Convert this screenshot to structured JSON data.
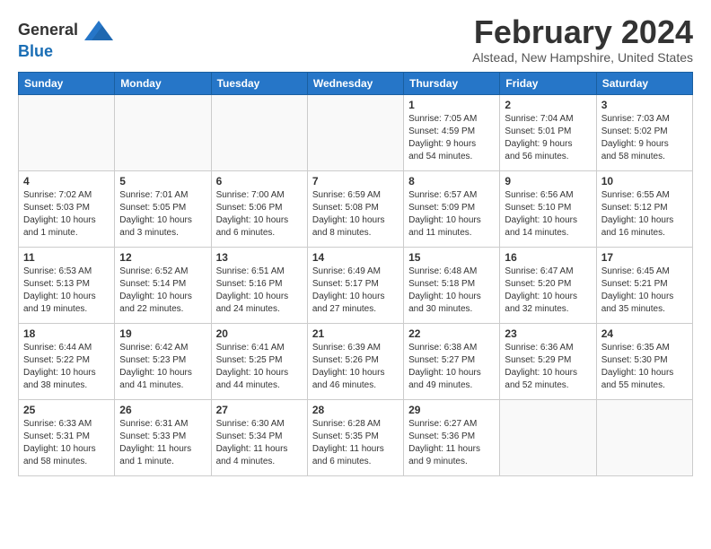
{
  "header": {
    "logo_line1": "General",
    "logo_line2": "Blue",
    "month_title": "February 2024",
    "location": "Alstead, New Hampshire, United States"
  },
  "weekdays": [
    "Sunday",
    "Monday",
    "Tuesday",
    "Wednesday",
    "Thursday",
    "Friday",
    "Saturday"
  ],
  "weeks": [
    [
      {
        "day": "",
        "info": ""
      },
      {
        "day": "",
        "info": ""
      },
      {
        "day": "",
        "info": ""
      },
      {
        "day": "",
        "info": ""
      },
      {
        "day": "1",
        "info": "Sunrise: 7:05 AM\nSunset: 4:59 PM\nDaylight: 9 hours\nand 54 minutes."
      },
      {
        "day": "2",
        "info": "Sunrise: 7:04 AM\nSunset: 5:01 PM\nDaylight: 9 hours\nand 56 minutes."
      },
      {
        "day": "3",
        "info": "Sunrise: 7:03 AM\nSunset: 5:02 PM\nDaylight: 9 hours\nand 58 minutes."
      }
    ],
    [
      {
        "day": "4",
        "info": "Sunrise: 7:02 AM\nSunset: 5:03 PM\nDaylight: 10 hours\nand 1 minute."
      },
      {
        "day": "5",
        "info": "Sunrise: 7:01 AM\nSunset: 5:05 PM\nDaylight: 10 hours\nand 3 minutes."
      },
      {
        "day": "6",
        "info": "Sunrise: 7:00 AM\nSunset: 5:06 PM\nDaylight: 10 hours\nand 6 minutes."
      },
      {
        "day": "7",
        "info": "Sunrise: 6:59 AM\nSunset: 5:08 PM\nDaylight: 10 hours\nand 8 minutes."
      },
      {
        "day": "8",
        "info": "Sunrise: 6:57 AM\nSunset: 5:09 PM\nDaylight: 10 hours\nand 11 minutes."
      },
      {
        "day": "9",
        "info": "Sunrise: 6:56 AM\nSunset: 5:10 PM\nDaylight: 10 hours\nand 14 minutes."
      },
      {
        "day": "10",
        "info": "Sunrise: 6:55 AM\nSunset: 5:12 PM\nDaylight: 10 hours\nand 16 minutes."
      }
    ],
    [
      {
        "day": "11",
        "info": "Sunrise: 6:53 AM\nSunset: 5:13 PM\nDaylight: 10 hours\nand 19 minutes."
      },
      {
        "day": "12",
        "info": "Sunrise: 6:52 AM\nSunset: 5:14 PM\nDaylight: 10 hours\nand 22 minutes."
      },
      {
        "day": "13",
        "info": "Sunrise: 6:51 AM\nSunset: 5:16 PM\nDaylight: 10 hours\nand 24 minutes."
      },
      {
        "day": "14",
        "info": "Sunrise: 6:49 AM\nSunset: 5:17 PM\nDaylight: 10 hours\nand 27 minutes."
      },
      {
        "day": "15",
        "info": "Sunrise: 6:48 AM\nSunset: 5:18 PM\nDaylight: 10 hours\nand 30 minutes."
      },
      {
        "day": "16",
        "info": "Sunrise: 6:47 AM\nSunset: 5:20 PM\nDaylight: 10 hours\nand 32 minutes."
      },
      {
        "day": "17",
        "info": "Sunrise: 6:45 AM\nSunset: 5:21 PM\nDaylight: 10 hours\nand 35 minutes."
      }
    ],
    [
      {
        "day": "18",
        "info": "Sunrise: 6:44 AM\nSunset: 5:22 PM\nDaylight: 10 hours\nand 38 minutes."
      },
      {
        "day": "19",
        "info": "Sunrise: 6:42 AM\nSunset: 5:23 PM\nDaylight: 10 hours\nand 41 minutes."
      },
      {
        "day": "20",
        "info": "Sunrise: 6:41 AM\nSunset: 5:25 PM\nDaylight: 10 hours\nand 44 minutes."
      },
      {
        "day": "21",
        "info": "Sunrise: 6:39 AM\nSunset: 5:26 PM\nDaylight: 10 hours\nand 46 minutes."
      },
      {
        "day": "22",
        "info": "Sunrise: 6:38 AM\nSunset: 5:27 PM\nDaylight: 10 hours\nand 49 minutes."
      },
      {
        "day": "23",
        "info": "Sunrise: 6:36 AM\nSunset: 5:29 PM\nDaylight: 10 hours\nand 52 minutes."
      },
      {
        "day": "24",
        "info": "Sunrise: 6:35 AM\nSunset: 5:30 PM\nDaylight: 10 hours\nand 55 minutes."
      }
    ],
    [
      {
        "day": "25",
        "info": "Sunrise: 6:33 AM\nSunset: 5:31 PM\nDaylight: 10 hours\nand 58 minutes."
      },
      {
        "day": "26",
        "info": "Sunrise: 6:31 AM\nSunset: 5:33 PM\nDaylight: 11 hours\nand 1 minute."
      },
      {
        "day": "27",
        "info": "Sunrise: 6:30 AM\nSunset: 5:34 PM\nDaylight: 11 hours\nand 4 minutes."
      },
      {
        "day": "28",
        "info": "Sunrise: 6:28 AM\nSunset: 5:35 PM\nDaylight: 11 hours\nand 6 minutes."
      },
      {
        "day": "29",
        "info": "Sunrise: 6:27 AM\nSunset: 5:36 PM\nDaylight: 11 hours\nand 9 minutes."
      },
      {
        "day": "",
        "info": ""
      },
      {
        "day": "",
        "info": ""
      }
    ]
  ]
}
